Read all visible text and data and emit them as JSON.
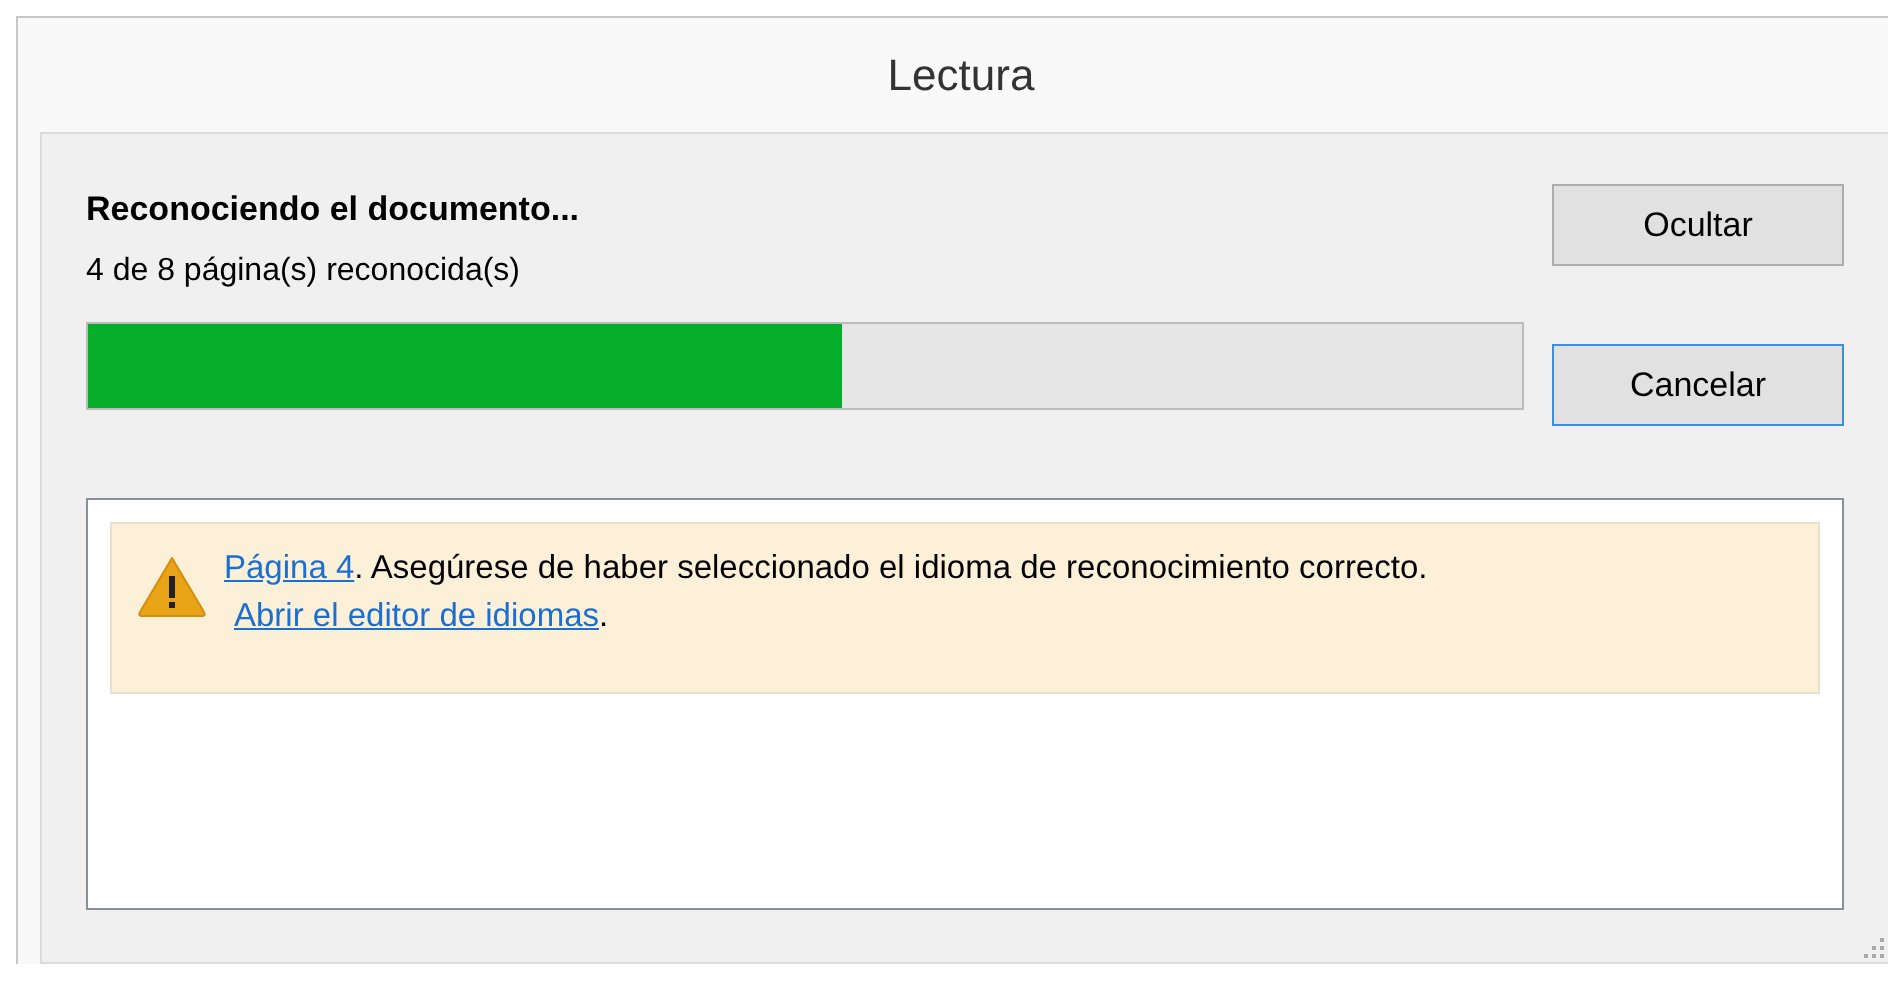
{
  "window": {
    "title": "Lectura"
  },
  "status": {
    "heading": "Reconociendo el documento...",
    "detail": "4 de 8 página(s) reconocida(s)"
  },
  "progress": {
    "level": 0.526
  },
  "buttons": [
    {
      "label": "Ocultar",
      "focused": false
    },
    {
      "label": "Cancelar",
      "focused": true
    }
  ],
  "warning": {
    "lines": [
      [
        {
          "kind": "link",
          "text": "Página 4"
        },
        {
          "kind": "text",
          "text": ". Asegúrese de haber seleccionado el idioma de reconocimiento correcto."
        }
      ],
      [
        {
          "kind": "link",
          "text": "Abrir el editor de idiomas"
        },
        {
          "kind": "text",
          "text": "."
        }
      ]
    ]
  }
}
